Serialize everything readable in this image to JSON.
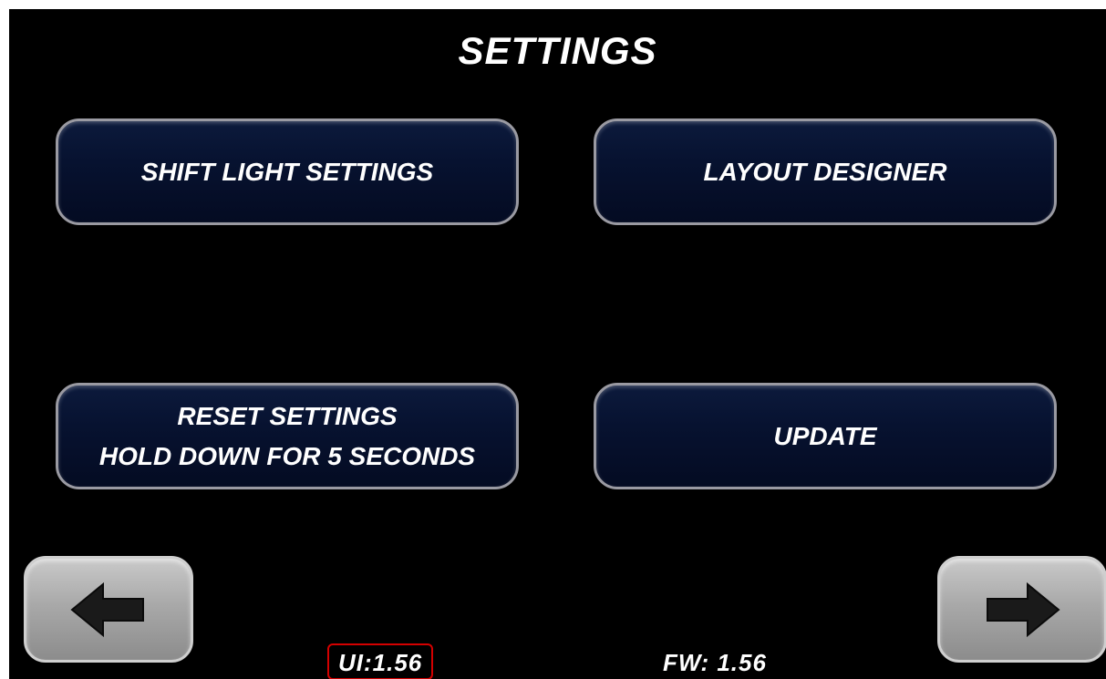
{
  "header": {
    "title": "SETTINGS"
  },
  "menu": {
    "shift_light": {
      "label": "SHIFT LIGHT SETTINGS"
    },
    "layout_designer": {
      "label": "LAYOUT DESIGNER"
    },
    "reset": {
      "line1": "RESET SETTINGS",
      "line2": "HOLD DOWN FOR 5 SECONDS"
    },
    "update": {
      "label": "UPDATE"
    }
  },
  "nav": {
    "back_icon": "left-arrow-icon",
    "next_icon": "right-arrow-icon"
  },
  "footer": {
    "ui_version": "UI:1.56",
    "fw_version": "FW: 1.56"
  },
  "colors": {
    "background": "#000000",
    "button_fill": "#071230",
    "button_border": "#9a9aa2",
    "nav_button": "#a9a9a9",
    "highlight_box": "#d40000"
  }
}
